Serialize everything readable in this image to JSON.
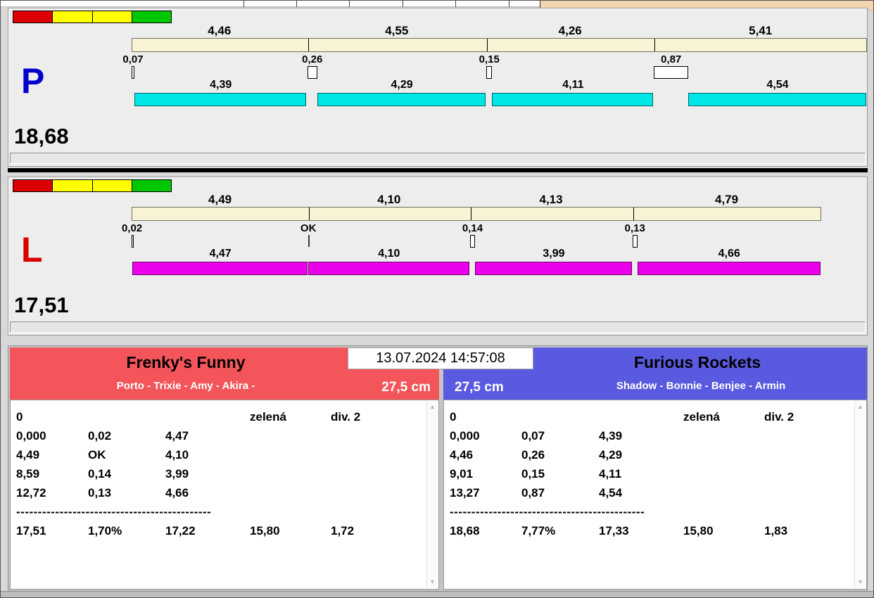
{
  "window": {
    "timestamp": "13.07.2024 14:57:08"
  },
  "lanes": [
    {
      "id": "P",
      "label": "P",
      "label_color": "#0000cd",
      "total": "18,68",
      "bar_color": "#00e6e6",
      "lights": [
        "#dd0000",
        "#ffff00",
        "#ffff00",
        "#00c800"
      ],
      "legs": [
        {
          "entry": "4,46",
          "change": "0,07",
          "dog": "4,39"
        },
        {
          "entry": "4,55",
          "change": "0,26",
          "dog": "4,29"
        },
        {
          "entry": "4,26",
          "change": "0,15",
          "dog": "4,11"
        },
        {
          "entry": "5,41",
          "change": "0,87",
          "dog": "4,54"
        }
      ]
    },
    {
      "id": "L",
      "label": "L",
      "label_color": "#dd0000",
      "total": "17,51",
      "bar_color": "#ea00ea",
      "lights": [
        "#dd0000",
        "#ffff00",
        "#ffff00",
        "#00c800"
      ],
      "legs": [
        {
          "entry": "4,49",
          "change": "0,02",
          "dog": "4,47"
        },
        {
          "entry": "4,10",
          "change": "OK",
          "dog": "4,10"
        },
        {
          "entry": "4,13",
          "change": "0,14",
          "dog": "3,99"
        },
        {
          "entry": "4,79",
          "change": "0,13",
          "dog": "4,66"
        }
      ]
    }
  ],
  "teams": [
    {
      "name": "Frenky's Funny",
      "members": "Porto - Trixie - Amy - Akira -",
      "height": "27,5 cm",
      "header_color": "#f4555a",
      "result": {
        "header_row": [
          "0",
          "",
          "",
          "zelená",
          "div. 2"
        ],
        "leg_rows": [
          [
            "0,000",
            "0,02",
            "4,47"
          ],
          [
            "4,49",
            "OK",
            "4,10"
          ],
          [
            "8,59",
            "0,14",
            "3,99"
          ],
          [
            "12,72",
            "0,13",
            "4,66"
          ]
        ],
        "separator": "---------------------------------------------",
        "total_row": [
          "17,51",
          "1,70%",
          "17,22",
          "15,80",
          "1,72"
        ]
      }
    },
    {
      "name": "Furious Rockets",
      "members": "Shadow - Bonnie - Benjee - Armin",
      "height": "27,5 cm",
      "header_color": "#5a5ae0",
      "result": {
        "header_row": [
          "0",
          "",
          "",
          "zelená",
          "div. 2"
        ],
        "leg_rows": [
          [
            "0,000",
            "0,07",
            "4,39"
          ],
          [
            "4,46",
            "0,26",
            "4,29"
          ],
          [
            "9,01",
            "0,15",
            "4,11"
          ],
          [
            "13,27",
            "0,87",
            "4,54"
          ]
        ],
        "separator": "---------------------------------------------",
        "total_row": [
          "18,68",
          "7,77%",
          "17,33",
          "15,80",
          "1,83"
        ]
      }
    }
  ]
}
